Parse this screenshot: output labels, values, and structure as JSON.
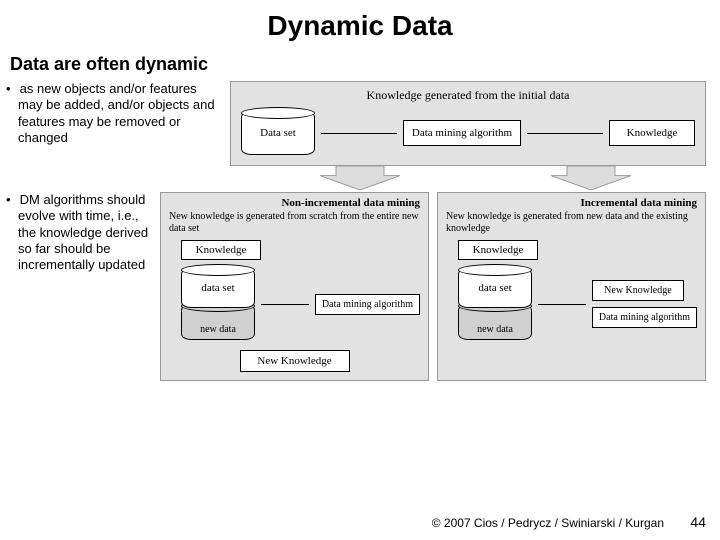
{
  "title": "Dynamic Data",
  "subtitle": "Data are often dynamic",
  "bullet1": "as new objects and/or features may be added, and/or objects and features may be removed or changed",
  "bullet2": "DM algorithms should evolve with time, i.e., the knowledge derived so far should be incrementally updated",
  "top": {
    "heading": "Knowledge generated from the initial data",
    "dataset": "Data set",
    "algo": "Data mining algorithm",
    "knowledge": "Knowledge"
  },
  "left": {
    "head": "Non-incremental data mining",
    "sub": "New knowledge is generated from scratch from the entire new data set",
    "knowledge": "Knowledge",
    "dataset": "data set",
    "newdata": "new data",
    "algo": "Data mining algorithm",
    "newk": "New Knowledge"
  },
  "right": {
    "head": "Incremental data mining",
    "sub": "New knowledge is generated from new data and the existing knowledge",
    "knowledge": "Knowledge",
    "dataset": "data set",
    "newdata": "new data",
    "newk": "New Knowledge",
    "algo": "Data mining algorithm"
  },
  "footer": "© 2007 Cios / Pedrycz / Swiniarski / Kurgan",
  "page": "44"
}
